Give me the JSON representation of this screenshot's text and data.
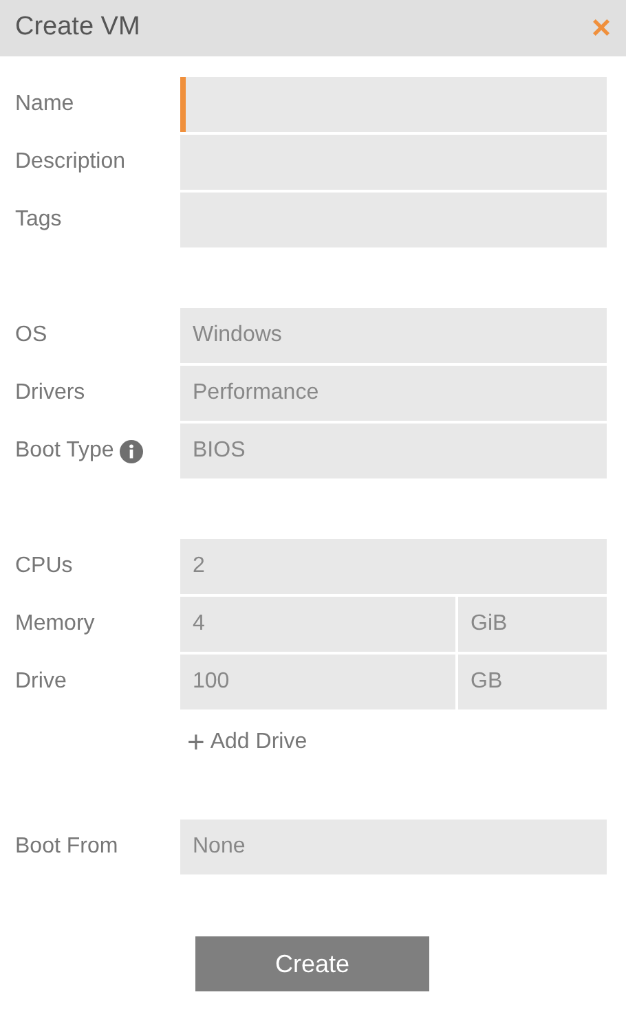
{
  "dialog": {
    "title": "Create VM",
    "close": "×"
  },
  "sections": [
    {
      "fields": [
        {
          "label": "Name",
          "focused": true
        },
        {
          "label": "Description",
          "focused": false
        },
        {
          "label": "Tags",
          "focused": false
        }
      ]
    },
    {
      "fields": [
        {
          "label": "OS",
          "value": "Windows",
          "focused": false
        },
        {
          "label": "Drivers",
          "value": "Performance",
          "focused": false
        },
        {
          "label": "Boot Type",
          "value": "BIOS",
          "focused": false,
          "info": true
        }
      ]
    },
    {
      "fields": [
        {
          "label": "CPUs",
          "value": "2",
          "focused": false
        },
        {
          "label": "Memory",
          "value": "4",
          "unit": "GiB",
          "focused": false
        },
        {
          "label": "Drive",
          "value": "100",
          "unit": "GB",
          "focused": false
        }
      ],
      "add_link": {
        "icon": "+",
        "label": "Add Drive"
      }
    },
    {
      "fields": [
        {
          "label": "Boot From",
          "value": "None",
          "focused": false
        }
      ]
    }
  ],
  "submit": "Create"
}
